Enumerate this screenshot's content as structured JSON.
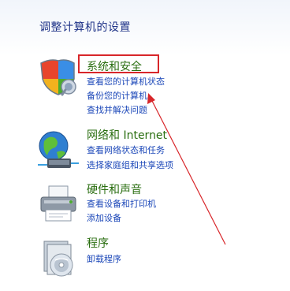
{
  "page": {
    "title": "调整计算机的设置"
  },
  "categories": [
    {
      "title": "系统和安全",
      "icon": "shield-icon",
      "links": [
        "查看您的计算机状态",
        "备份您的计算机",
        "查找并解决问题"
      ]
    },
    {
      "title": "网络和 Internet",
      "icon": "network-globe-icon",
      "links": [
        "查看网络状态和任务",
        "选择家庭组和共享选项"
      ]
    },
    {
      "title": "硬件和声音",
      "icon": "printer-icon",
      "links": [
        "查看设备和打印机",
        "添加设备"
      ]
    },
    {
      "title": "程序",
      "icon": "programs-disc-icon",
      "links": [
        "卸载程序"
      ]
    }
  ],
  "colors": {
    "category_title": "#2a6e10",
    "link": "#1a46b8",
    "page_title": "#1e3287",
    "annotation": "#d8262a"
  }
}
